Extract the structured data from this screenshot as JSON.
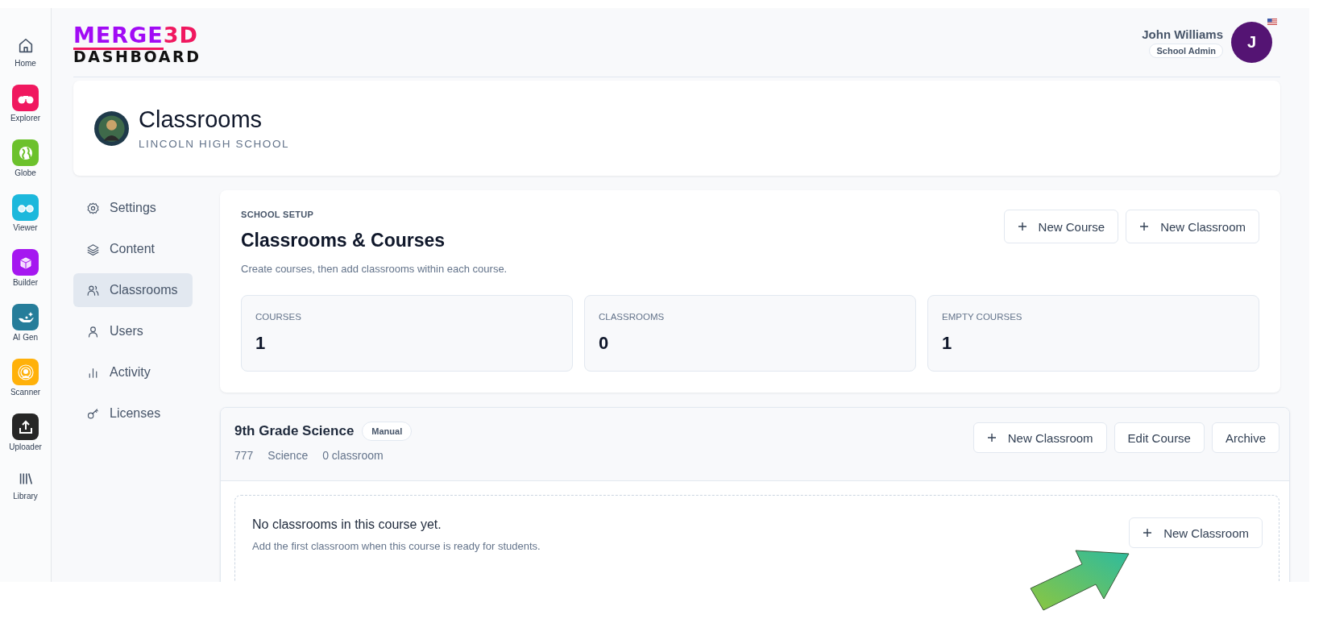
{
  "rail": [
    {
      "label": "Home",
      "kind": "plain"
    },
    {
      "label": "Explorer",
      "kind": "app",
      "color": "#f0185f"
    },
    {
      "label": "Globe",
      "kind": "app",
      "color": "#6cc12c"
    },
    {
      "label": "Viewer",
      "kind": "app",
      "color": "#1cb8dc"
    },
    {
      "label": "Builder",
      "kind": "app",
      "color": "#a517f0"
    },
    {
      "label": "AI Gen",
      "kind": "app",
      "color": "#267d9a"
    },
    {
      "label": "Scanner",
      "kind": "app",
      "color": "#ffb10a"
    },
    {
      "label": "Uploader",
      "kind": "app",
      "color": "#262626"
    },
    {
      "label": "Library",
      "kind": "plain"
    }
  ],
  "brand": {
    "name": "MERGE",
    "suffix": "3D",
    "subtitle": "DASHBOARD"
  },
  "user": {
    "name": "John Williams",
    "role": "School Admin",
    "initial": "J"
  },
  "page": {
    "title": "Classrooms",
    "school": "LINCOLN HIGH SCHOOL"
  },
  "nav": [
    {
      "label": "Settings",
      "selected": false
    },
    {
      "label": "Content",
      "selected": false
    },
    {
      "label": "Classrooms",
      "selected": true
    },
    {
      "label": "Users",
      "selected": false
    },
    {
      "label": "Activity",
      "selected": false
    },
    {
      "label": "Licenses",
      "selected": false
    }
  ],
  "setup": {
    "eyebrow": "SCHOOL SETUP",
    "title": "Classrooms & Courses",
    "description": "Create courses, then add classrooms within each course.",
    "buttons": [
      "New Course",
      "New Classroom"
    ],
    "stats": [
      {
        "label": "COURSES",
        "value": "1"
      },
      {
        "label": "CLASSROOMS",
        "value": "0"
      },
      {
        "label": "EMPTY COURSES",
        "value": "1"
      }
    ]
  },
  "course": {
    "title": "9th Grade Science",
    "badge": "Manual",
    "meta": [
      "777",
      "Science",
      "0 classroom"
    ],
    "buttons": [
      {
        "label": "New Classroom",
        "kind": "add"
      },
      {
        "label": "Edit Course",
        "kind": "plain"
      },
      {
        "label": "Archive",
        "kind": "plain"
      }
    ],
    "empty": {
      "title": "No classrooms in this course yet.",
      "text": "Add the first classroom when this course is ready for students.",
      "button": "New Classroom"
    }
  }
}
